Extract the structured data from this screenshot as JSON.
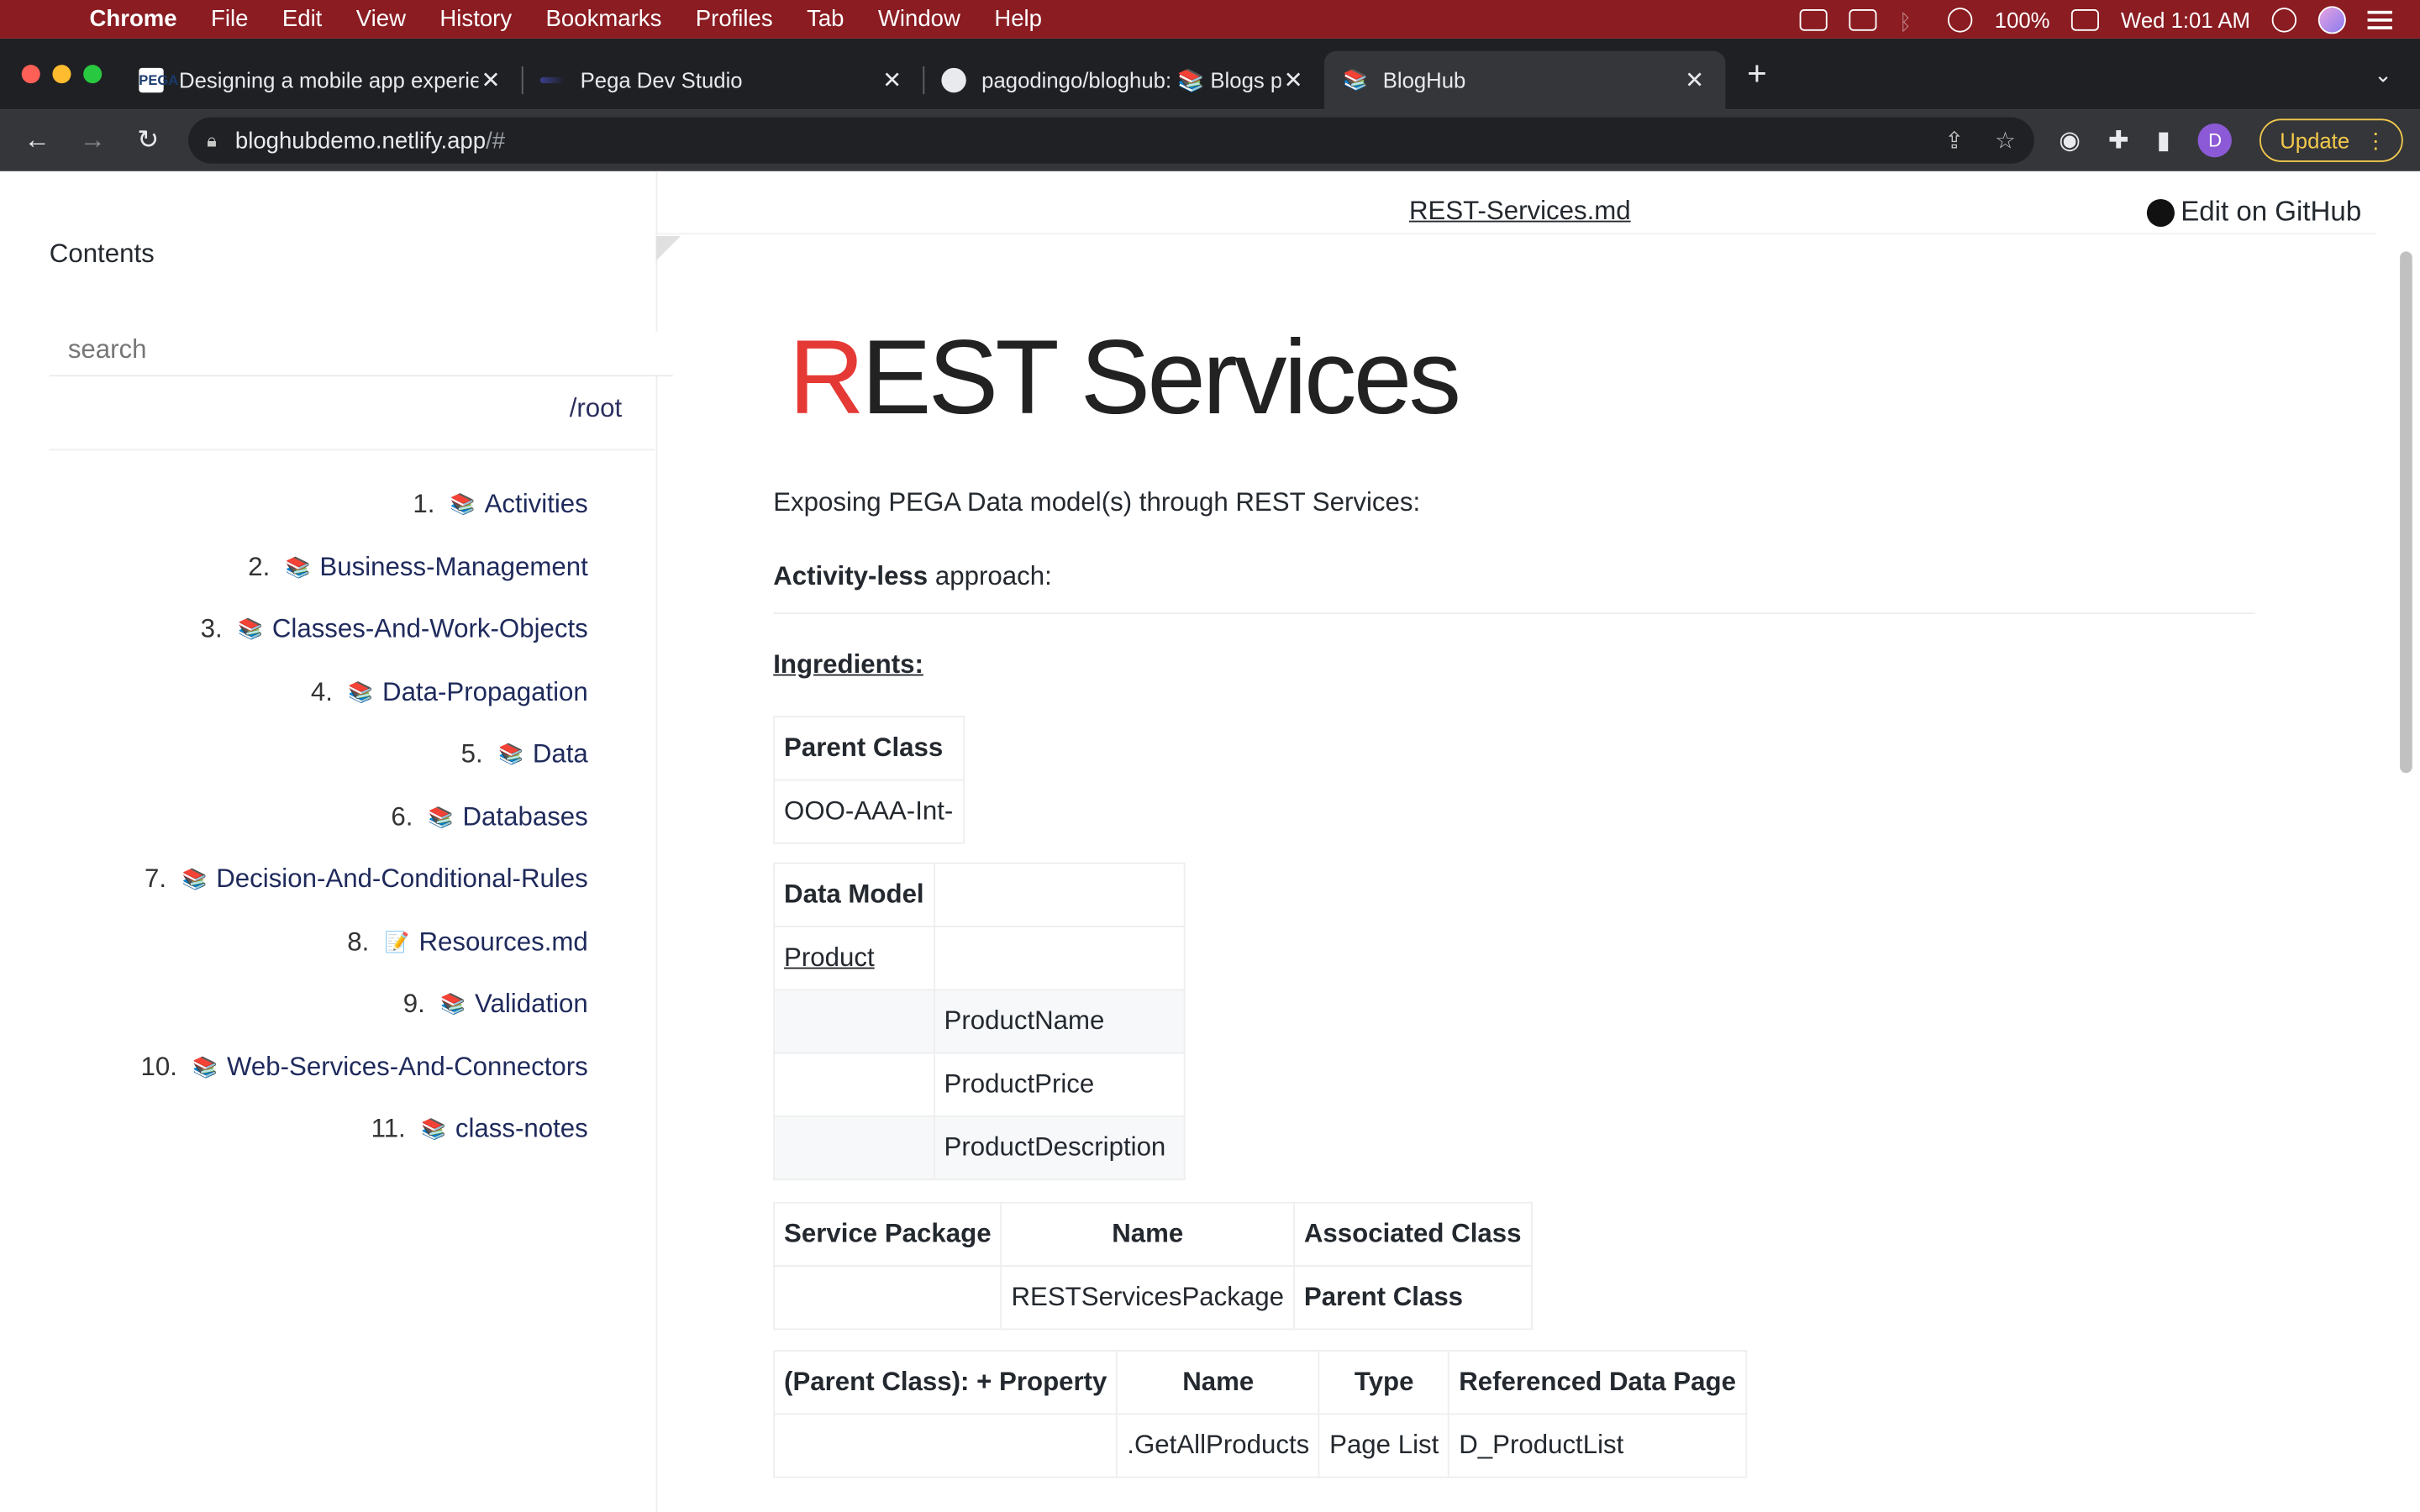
{
  "menubar": {
    "app": "Chrome",
    "items": [
      "File",
      "Edit",
      "View",
      "History",
      "Bookmarks",
      "Profiles",
      "Tab",
      "Window",
      "Help"
    ],
    "battery": "100%",
    "clock": "Wed 1:01 AM"
  },
  "tabs": [
    {
      "title": "Designing a mobile app experie",
      "favicon": "PEGA"
    },
    {
      "title": "Pega Dev Studio",
      "favicon": ""
    },
    {
      "title": "pagodingo/bloghub: 📚 Blogs p",
      "favicon": "github-icon"
    },
    {
      "title": "BlogHub",
      "favicon": "📚"
    }
  ],
  "toolbar": {
    "url_host": "bloghubdemo.netlify.app",
    "url_path": "/#",
    "profile_initial": "D",
    "update_label": "Update"
  },
  "sidebar": {
    "title": "Contents",
    "search_placeholder": "search",
    "root_label": "/root",
    "items": [
      {
        "num": "1.",
        "emoji": "📚",
        "label": "Activities"
      },
      {
        "num": "2.",
        "emoji": "📚",
        "label": "Business-Management"
      },
      {
        "num": "3.",
        "emoji": "📚",
        "label": "Classes-And-Work-Objects"
      },
      {
        "num": "4.",
        "emoji": "📚",
        "label": "Data-Propagation"
      },
      {
        "num": "5.",
        "emoji": "📚",
        "label": "Data"
      },
      {
        "num": "6.",
        "emoji": "📚",
        "label": "Databases"
      },
      {
        "num": "7.",
        "emoji": "📚",
        "label": "Decision-And-Conditional-Rules"
      },
      {
        "num": "8.",
        "emoji": "📝",
        "label": "Resources.md"
      },
      {
        "num": "9.",
        "emoji": "📚",
        "label": "Validation"
      },
      {
        "num": "10.",
        "emoji": "📚",
        "label": "Web-Services-And-Connectors"
      },
      {
        "num": "11.",
        "emoji": "📚",
        "label": "class-notes"
      }
    ]
  },
  "header": {
    "file_link": "REST-Services.md",
    "edit_label": "Edit on GitHub"
  },
  "article": {
    "title_first": "R",
    "title_rest": "EST Services",
    "intro": "Exposing PEGA Data model(s) through REST Services:",
    "approach_bold": "Activity-less",
    "approach_rest": " approach:",
    "ingredients": "Ingredients:",
    "table1": {
      "header": "Parent Class",
      "value": "OOO-AAA-Int-"
    },
    "table2": {
      "header": "Data Model",
      "link": "Product",
      "rows": [
        "ProductName",
        "ProductPrice",
        "ProductDescription"
      ]
    },
    "table3": {
      "headers": [
        "Service Package",
        "Name",
        "Associated Class"
      ],
      "row": [
        "",
        "RESTServicesPackage",
        "Parent Class"
      ]
    },
    "table4": {
      "headers": [
        "(Parent Class): + Property",
        "Name",
        "Type",
        "Referenced Data Page"
      ],
      "row": [
        "",
        ".GetAllProducts",
        "Page List",
        "D_ProductList"
      ]
    }
  }
}
